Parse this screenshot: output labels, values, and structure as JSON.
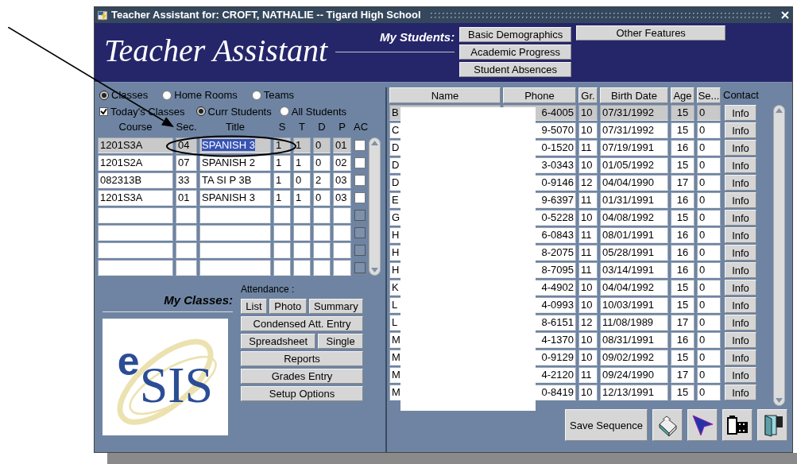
{
  "window": {
    "title": "Teacher Assistant for: CROFT, NATHALIE -- Tigard High School"
  },
  "header": {
    "app_name": "Teacher Assistant",
    "students_label": "My Students:",
    "student_buttons": [
      "Basic Demographics",
      "Academic Progress",
      "Student Absences"
    ],
    "other_button": "Other Features"
  },
  "view_modes": [
    {
      "label": "Classes",
      "selected": true
    },
    {
      "label": "Home Rooms",
      "selected": false
    },
    {
      "label": "Teams",
      "selected": false
    }
  ],
  "todays_classes": {
    "label": "Today's Classes",
    "checked": true
  },
  "student_filter": [
    {
      "label": "Curr Students",
      "selected": true
    },
    {
      "label": "All Students",
      "selected": false
    }
  ],
  "classes_table": {
    "columns": [
      "Course",
      "Sec.",
      "Title",
      "S",
      "T",
      "D",
      "P",
      "AC"
    ],
    "rows": [
      {
        "course": "1201S3A",
        "sec": "04",
        "title": "SPANISH 3",
        "s": "1",
        "t": "1",
        "d": "0",
        "p": "01",
        "ac": false,
        "selected": true
      },
      {
        "course": "1201S2A",
        "sec": "07",
        "title": "SPANISH 2",
        "s": "1",
        "t": "1",
        "d": "0",
        "p": "02",
        "ac": false,
        "selected": false
      },
      {
        "course": "082313B",
        "sec": "33",
        "title": "TA SI P 3B",
        "s": "1",
        "t": "0",
        "d": "2",
        "p": "03",
        "ac": false,
        "selected": false
      },
      {
        "course": "1201S3A",
        "sec": "01",
        "title": "SPANISH 3",
        "s": "1",
        "t": "1",
        "d": "0",
        "p": "03",
        "ac": false,
        "selected": false
      }
    ],
    "empty_rows": [
      {
        "ac_disabled": true
      },
      {
        "ac_disabled": true
      },
      {
        "ac_disabled": true
      },
      {
        "ac_disabled": true
      }
    ]
  },
  "my_classes": {
    "label": "My Classes:",
    "logo": {
      "prefix": "e",
      "name": "SIS"
    }
  },
  "attendance": {
    "label": "Attendance :",
    "buttons": [
      [
        "List",
        "Photo",
        "Summary"
      ],
      [
        "Condensed Att. Entry"
      ],
      [
        "Spreadsheet",
        "Single"
      ],
      [
        "Reports"
      ],
      [
        "Grades Entry"
      ],
      [
        "Setup Options"
      ]
    ]
  },
  "students_table": {
    "columns": [
      "Name",
      "Phone",
      "Gr.",
      "Birth Date",
      "Age",
      "Se...",
      "Contact"
    ],
    "rows": [
      {
        "name": "B",
        "phone": "6-4005",
        "grade": "10",
        "birth": "07/31/1992",
        "age": "15",
        "se": "0",
        "contact": "Info",
        "selected": true
      },
      {
        "name": "C",
        "phone": "9-5070",
        "grade": "10",
        "birth": "07/31/1992",
        "age": "15",
        "se": "0",
        "contact": "Info",
        "selected": false
      },
      {
        "name": "D",
        "phone": "0-1520",
        "grade": "11",
        "birth": "07/19/1991",
        "age": "16",
        "se": "0",
        "contact": "Info",
        "selected": false
      },
      {
        "name": "D",
        "phone": "3-0343",
        "grade": "10",
        "birth": "01/05/1992",
        "age": "15",
        "se": "0",
        "contact": "Info",
        "selected": false
      },
      {
        "name": "D",
        "phone": "0-9146",
        "grade": "12",
        "birth": "04/04/1990",
        "age": "17",
        "se": "0",
        "contact": "Info",
        "selected": false
      },
      {
        "name": "E",
        "phone": "9-6397",
        "grade": "11",
        "birth": "01/31/1991",
        "age": "16",
        "se": "0",
        "contact": "Info",
        "selected": false
      },
      {
        "name": "G",
        "phone": "0-5228",
        "grade": "10",
        "birth": "04/08/1992",
        "age": "15",
        "se": "0",
        "contact": "Info",
        "selected": false
      },
      {
        "name": "H",
        "phone": "6-0843",
        "grade": "11",
        "birth": "08/01/1991",
        "age": "16",
        "se": "0",
        "contact": "Info",
        "selected": false
      },
      {
        "name": "H",
        "phone": "8-2075",
        "grade": "11",
        "birth": "05/28/1991",
        "age": "16",
        "se": "0",
        "contact": "Info",
        "selected": false
      },
      {
        "name": "H",
        "phone": "8-7095",
        "grade": "11",
        "birth": "03/14/1991",
        "age": "16",
        "se": "0",
        "contact": "Info",
        "selected": false
      },
      {
        "name": "K",
        "phone": "4-4902",
        "grade": "10",
        "birth": "04/04/1992",
        "age": "15",
        "se": "0",
        "contact": "Info",
        "selected": false
      },
      {
        "name": "L",
        "phone": "4-0993",
        "grade": "10",
        "birth": "10/03/1991",
        "age": "15",
        "se": "0",
        "contact": "Info",
        "selected": false
      },
      {
        "name": "L",
        "phone": "8-6151",
        "grade": "12",
        "birth": "11/08/1989",
        "age": "17",
        "se": "0",
        "contact": "Info",
        "selected": false
      },
      {
        "name": "M",
        "phone": "4-1370",
        "grade": "10",
        "birth": "08/31/1991",
        "age": "16",
        "se": "0",
        "contact": "Info",
        "selected": false
      },
      {
        "name": "M",
        "phone": "0-9129",
        "grade": "10",
        "birth": "09/02/1992",
        "age": "15",
        "se": "0",
        "contact": "Info",
        "selected": false
      },
      {
        "name": "M",
        "phone": "4-2120",
        "grade": "11",
        "birth": "09/24/1990",
        "age": "17",
        "se": "0",
        "contact": "Info",
        "selected": false
      },
      {
        "name": "M",
        "phone": "0-8419",
        "grade": "10",
        "birth": "12/13/1991",
        "age": "15",
        "se": "0",
        "contact": "Info",
        "selected": false
      }
    ]
  },
  "footer": {
    "save_button": "Save Sequence"
  }
}
